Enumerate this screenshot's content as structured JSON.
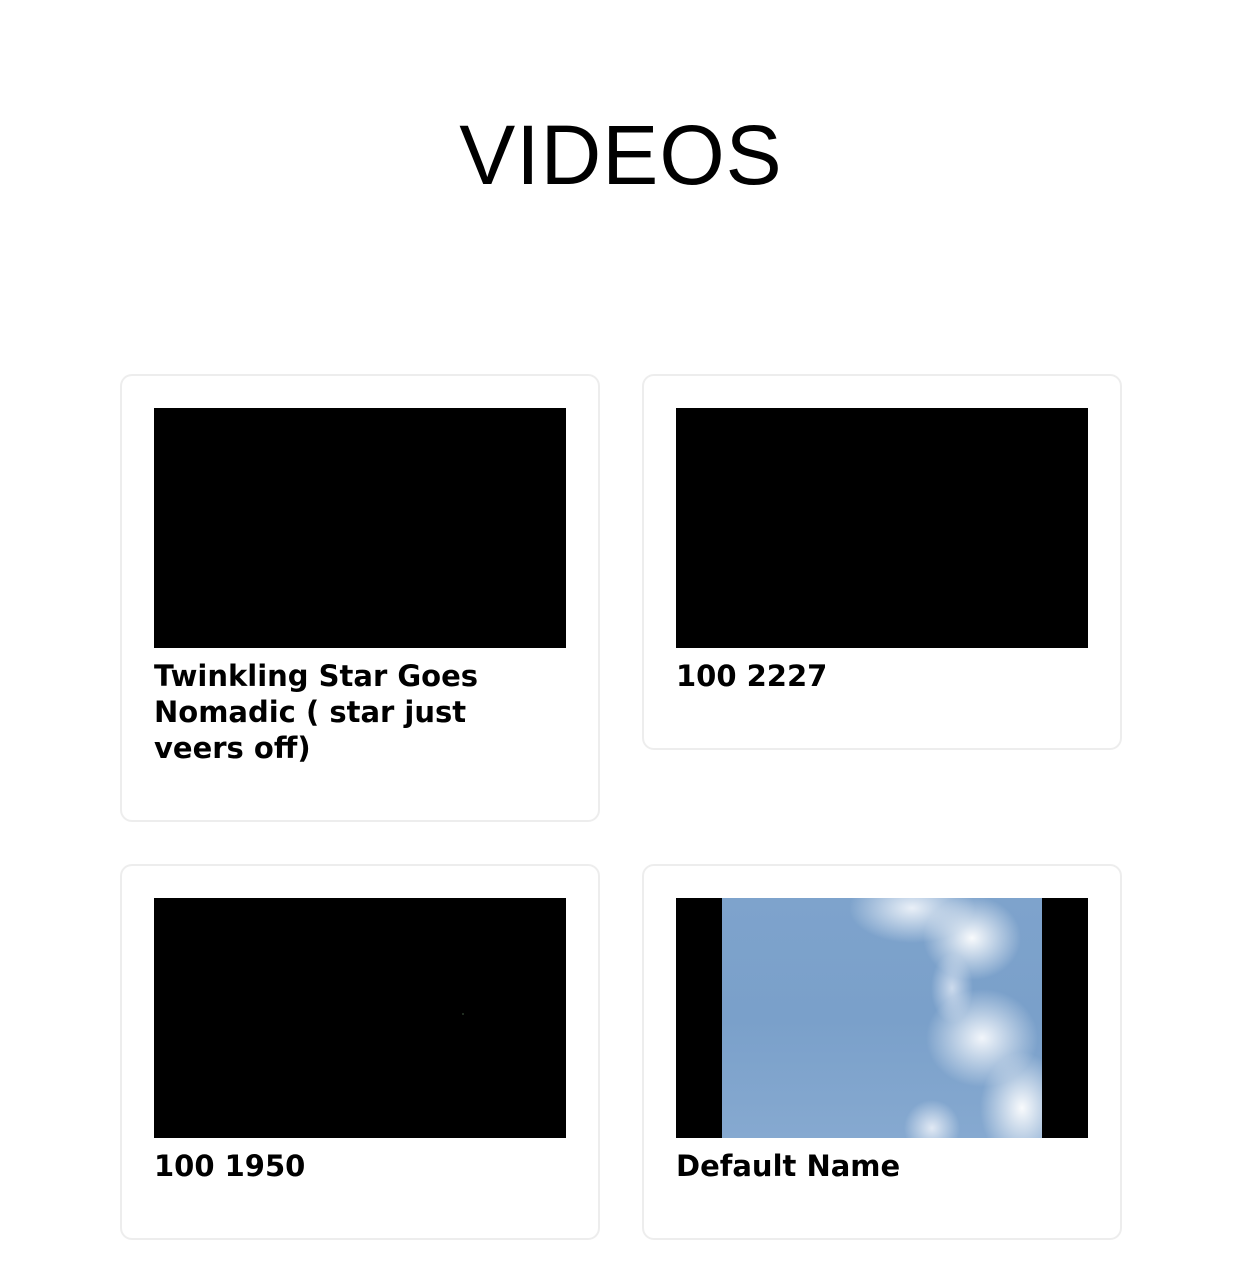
{
  "page": {
    "title": "VIDEOS"
  },
  "videos": [
    {
      "title": "Twinkling Star Goes Nomadic ( star just veers off)",
      "thumbnail": "black-frame"
    },
    {
      "title": "100 2227",
      "thumbnail": "black-frame"
    },
    {
      "title": "100 1950",
      "thumbnail": "black-frame-with-star"
    },
    {
      "title": "Default Name",
      "thumbnail": "blue-sky-clouds"
    }
  ],
  "colors": {
    "background": "#ffffff",
    "card_border": "#ededed",
    "thumbnail_bg": "#000000",
    "sky_blue": "#7ea3cc"
  }
}
